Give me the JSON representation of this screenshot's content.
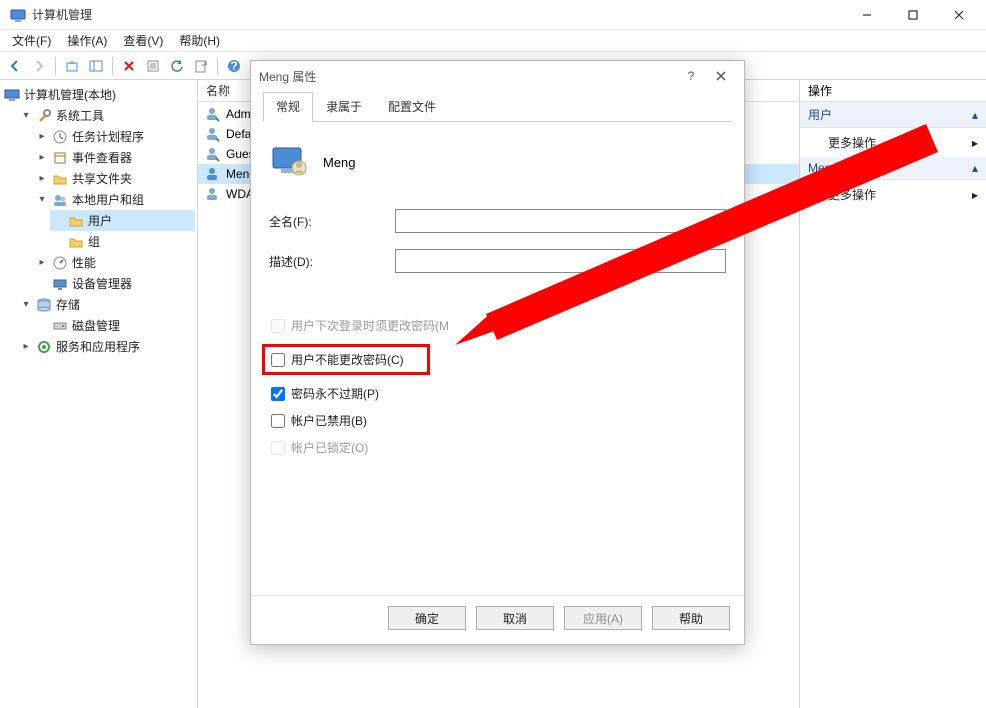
{
  "window": {
    "title": "计算机管理"
  },
  "menubar": {
    "file": "文件(F)",
    "action": "操作(A)",
    "view": "查看(V)",
    "help": "帮助(H)"
  },
  "tree": {
    "root": "计算机管理(本地)",
    "systemTools": "系统工具",
    "taskScheduler": "任务计划程序",
    "eventViewer": "事件查看器",
    "sharedFolders": "共享文件夹",
    "localUsersGroups": "本地用户和组",
    "users": "用户",
    "groups": "组",
    "performance": "性能",
    "deviceMgr": "设备管理器",
    "storage": "存储",
    "diskMgmt": "磁盘管理",
    "servicesApps": "服务和应用程序"
  },
  "centerHeader": "名称",
  "userList": [
    {
      "name": "Admi"
    },
    {
      "name": "Defau"
    },
    {
      "name": "Gues"
    },
    {
      "name": "Meng"
    },
    {
      "name": "WDA"
    }
  ],
  "actions": {
    "header": "操作",
    "groupUser": "用户",
    "moreActions": "更多操作",
    "groupMeng": "Meng"
  },
  "dialog": {
    "title": "Meng 属性",
    "tabs": {
      "general": "常规",
      "memberOf": "隶属于",
      "profile": "配置文件"
    },
    "userName": "Meng",
    "fullNameLabel": "全名(F):",
    "fullNameValue": "",
    "descLabel": "描述(D):",
    "descValue": "",
    "chkMustChange": "用户下次登录时须更改密码(M",
    "chkCannotChange": "用户不能更改密码(C)",
    "chkNeverExpires": "密码永不过期(P)",
    "chkDisabled": "帐户已禁用(B)",
    "chkLocked": "帐户已锁定(O)",
    "buttons": {
      "ok": "确定",
      "cancel": "取消",
      "apply": "应用(A)",
      "help": "帮助"
    }
  }
}
